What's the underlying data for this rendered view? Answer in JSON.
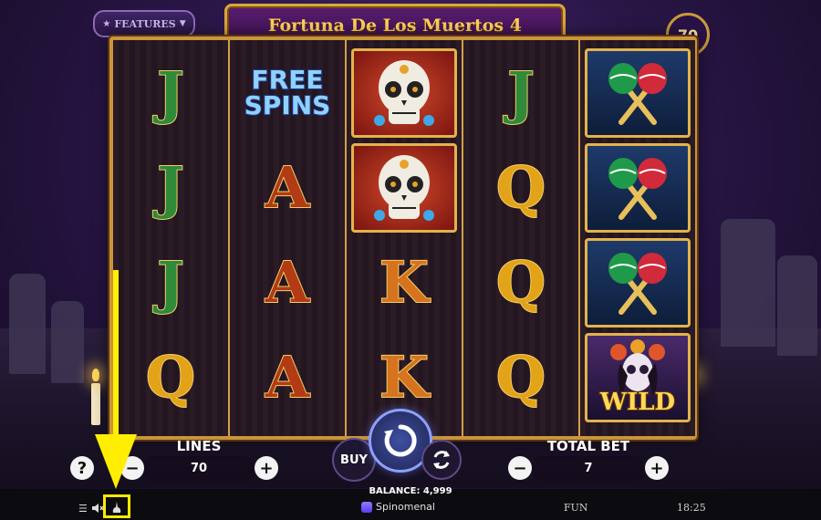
{
  "game": {
    "title": "Fortuna De Los Muertos 4",
    "features_label": "FEATURES",
    "lines_badge": "70"
  },
  "reels": [
    [
      "J",
      "J",
      "J",
      "Q"
    ],
    [
      "FREE SPINS",
      "A",
      "A",
      "A"
    ],
    [
      "skull",
      "skull",
      "K",
      "K"
    ],
    [
      "J",
      "Q",
      "Q",
      "Q"
    ],
    [
      "maracas",
      "maracas",
      "maracas",
      "WILD"
    ]
  ],
  "symbols": {
    "free_spins_line1": "FREE",
    "free_spins_line2": "SPINS",
    "wild": "WILD"
  },
  "controls": {
    "help": "?",
    "lines_label": "LINES",
    "lines_value": "70",
    "minus": "−",
    "plus": "+",
    "buy": "BUY",
    "total_bet_label": "TOTAL BET",
    "total_bet_value": "7"
  },
  "footer": {
    "balance": "BALANCE: 4,999",
    "brand": "Spinomenal",
    "mode": "FUN",
    "time": "18:25"
  },
  "colors": {
    "accent_gold": "#d9a93a",
    "highlight": "#ffee00"
  }
}
